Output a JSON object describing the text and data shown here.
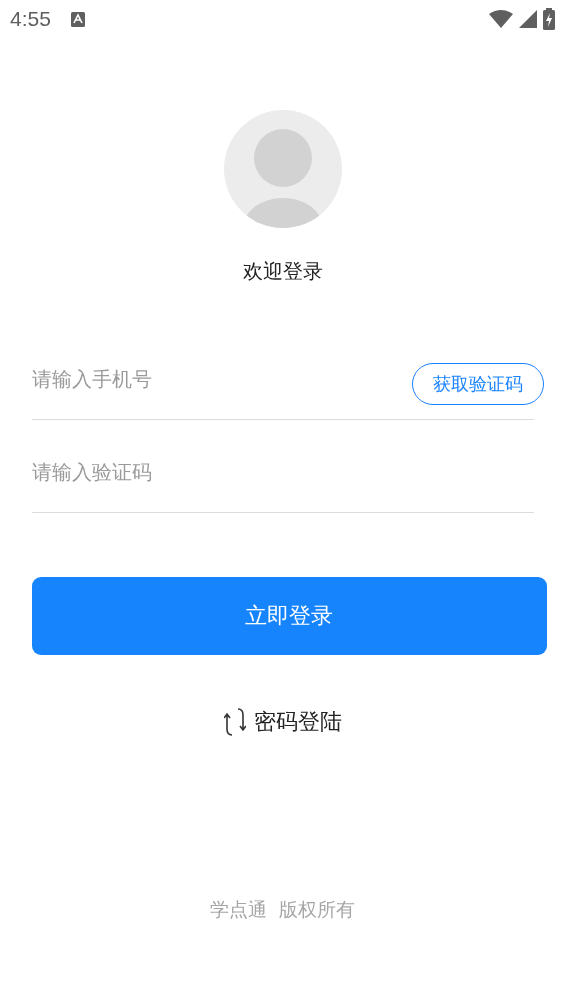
{
  "status_bar": {
    "time": "4:55"
  },
  "welcome": "欢迎登录",
  "phone_field": {
    "placeholder": "请输入手机号"
  },
  "code_button": "获取验证码",
  "code_field": {
    "placeholder": "请输入验证码"
  },
  "login_button": "立即登录",
  "switch_link": "密码登陆",
  "footer": [
    "学点通",
    "版权所有"
  ]
}
